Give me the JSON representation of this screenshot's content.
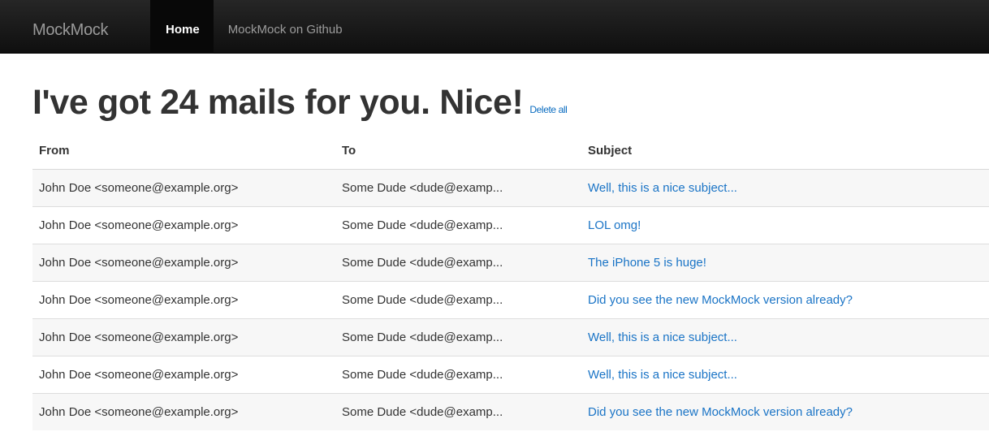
{
  "navbar": {
    "brand": "MockMock",
    "items": [
      {
        "label": "Home",
        "active": true
      },
      {
        "label": "MockMock on Github",
        "active": false
      }
    ]
  },
  "main": {
    "title": "I've got 24 mails for you. Nice!",
    "delete_all_label": "Delete all",
    "table": {
      "headers": {
        "from": "From",
        "to": "To",
        "subject": "Subject"
      },
      "rows": [
        {
          "from": "John Doe <someone@example.org>",
          "to": "Some Dude <dude@examp...",
          "subject": "Well, this is a nice subject..."
        },
        {
          "from": "John Doe <someone@example.org>",
          "to": "Some Dude <dude@examp...",
          "subject": "LOL omg!"
        },
        {
          "from": "John Doe <someone@example.org>",
          "to": "Some Dude <dude@examp...",
          "subject": "The iPhone 5 is huge!"
        },
        {
          "from": "John Doe <someone@example.org>",
          "to": "Some Dude <dude@examp...",
          "subject": "Did you see the new MockMock version already?"
        },
        {
          "from": "John Doe <someone@example.org>",
          "to": "Some Dude <dude@examp...",
          "subject": "Well, this is a nice subject..."
        },
        {
          "from": "John Doe <someone@example.org>",
          "to": "Some Dude <dude@examp...",
          "subject": "Well, this is a nice subject..."
        },
        {
          "from": "John Doe <someone@example.org>",
          "to": "Some Dude <dude@examp...",
          "subject": "Did you see the new MockMock version already?"
        }
      ]
    }
  },
  "colors": {
    "navbar_bg": "#1b1b1b",
    "link": "#1a74c6",
    "text": "#333333"
  }
}
